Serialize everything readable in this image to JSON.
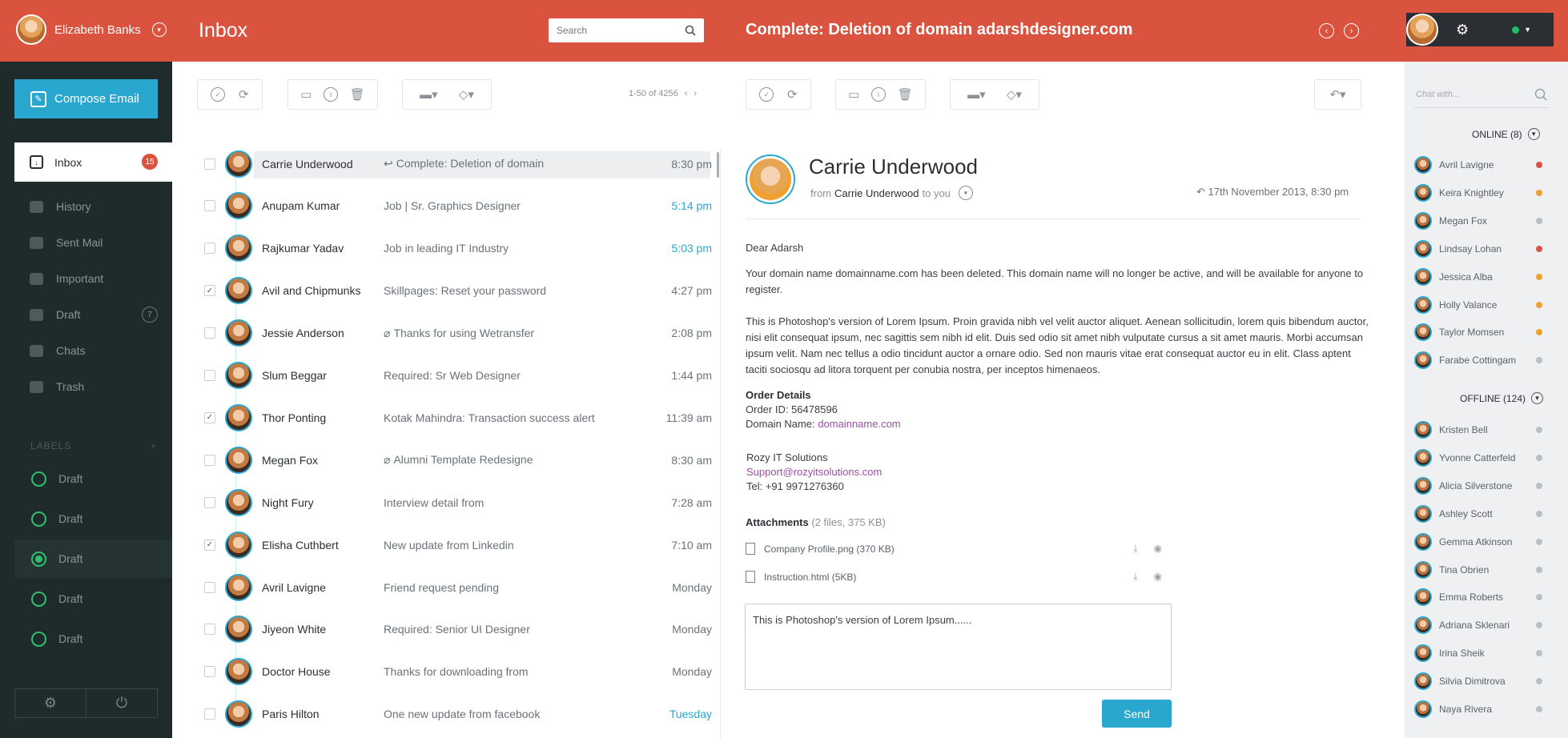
{
  "user": {
    "name": "Elizabeth Banks"
  },
  "header": {
    "title": "Inbox",
    "search_placeholder": "Search",
    "subject": "Complete: Deletion of domain adarshdesigner.com"
  },
  "sidebar": {
    "compose_label": "Compose Email",
    "inbox": {
      "label": "Inbox",
      "count": "15"
    },
    "items": [
      {
        "label": "History"
      },
      {
        "label": "Sent Mail"
      },
      {
        "label": "Important"
      },
      {
        "label": "Draft",
        "count": "7"
      },
      {
        "label": "Chats"
      },
      {
        "label": "Trash"
      }
    ],
    "labels_title": "LABELS",
    "labels_add": "+",
    "labels": [
      {
        "label": "Draft"
      },
      {
        "label": "Draft"
      },
      {
        "label": "Draft",
        "active": true
      },
      {
        "label": "Draft"
      },
      {
        "label": "Draft"
      }
    ]
  },
  "list": {
    "pager": "1-50 of 4256",
    "rows": [
      {
        "sender": "Carrie Underwood",
        "subject": "Complete: Deletion of domain",
        "time": "8:30 pm",
        "prefix": "↩",
        "selected": true,
        "checked": false,
        "time_color": "#6a7278"
      },
      {
        "sender": "Anupam Kumar",
        "subject": "Job | Sr. Graphics Designer",
        "time": "5:14 pm",
        "prefix": "",
        "checked": false,
        "time_color": "#2aa7cf"
      },
      {
        "sender": "Rajkumar Yadav",
        "subject": "Job in leading IT Industry",
        "time": "5:03 pm",
        "prefix": "",
        "checked": false,
        "time_color": "#2aa7cf"
      },
      {
        "sender": "Avil and Chipmunks",
        "subject": "Skillpages: Reset your password",
        "time": "4:27 pm",
        "prefix": "",
        "checked": true,
        "time_color": "#6a7278"
      },
      {
        "sender": "Jessie Anderson",
        "subject": "Thanks for using Wetransfer",
        "time": "2:08 pm",
        "prefix": "⌀",
        "checked": false,
        "time_color": "#6a7278"
      },
      {
        "sender": "Slum Beggar",
        "subject": "Required: Sr Web Designer",
        "time": "1:44 pm",
        "prefix": "",
        "checked": false,
        "time_color": "#6a7278"
      },
      {
        "sender": "Thor Ponting",
        "subject": "Kotak Mahindra: Transaction success alert",
        "time": "11:39 am",
        "prefix": "",
        "checked": true,
        "time_color": "#6a7278"
      },
      {
        "sender": "Megan Fox",
        "subject": "Alumni Template Redesigne",
        "time": "8:30 am",
        "prefix": "⌀",
        "checked": false,
        "time_color": "#6a7278"
      },
      {
        "sender": "Night Fury",
        "subject": "Interview detail from",
        "time": "7:28 am",
        "prefix": "",
        "checked": false,
        "time_color": "#6a7278"
      },
      {
        "sender": "Elisha Cuthbert",
        "subject": "New update from Linkedin",
        "time": "7:10 am",
        "prefix": "",
        "checked": true,
        "time_color": "#6a7278"
      },
      {
        "sender": "Avril Lavigne",
        "subject": "Friend request pending",
        "time": "Monday",
        "prefix": "",
        "checked": false,
        "time_color": "#6a7278"
      },
      {
        "sender": "Jiyeon White",
        "subject": "Required: Senior UI Designer",
        "time": "Monday",
        "prefix": "",
        "checked": false,
        "time_color": "#6a7278"
      },
      {
        "sender": "Doctor House",
        "subject": "Thanks for downloading from",
        "time": "Monday",
        "prefix": "",
        "checked": false,
        "time_color": "#6a7278"
      },
      {
        "sender": "Paris Hilton",
        "subject": "One new update from facebook",
        "time": "Tuesday",
        "prefix": "",
        "checked": false,
        "time_color": "#2aa7cf"
      }
    ]
  },
  "mail": {
    "sender": "Carrie Underwood",
    "from_label": "from",
    "to_label": "to you",
    "date": "17th November 2013, 8:30 pm",
    "greeting": "Dear Adarsh",
    "p1": "Your domain name domainname.com has been deleted. This domain name will no longer be active, and will be available for anyone to register.",
    "p2": "This is Photoshop's version  of Lorem Ipsum. Proin gravida nibh vel velit auctor aliquet. Aenean sollicitudin, lorem quis bibendum auctor, nisi elit consequat ipsum, nec sagittis sem nibh id elit. Duis sed odio sit amet nibh vulputate cursus a sit amet mauris. Morbi accumsan ipsum velit. Nam nec tellus a odio tincidunt auctor a ornare odio. Sed non  mauris vitae erat consequat auctor eu in elit. Class aptent taciti sociosqu ad litora torquent per conubia nostra, per inceptos himenaeos.",
    "order_title": "Order Details",
    "order_id": "Order ID: 56478596",
    "domain_label": "Domain Name: ",
    "domain": "domainname.com",
    "company": "Rozy IT Solutions",
    "support": "Support@rozyitsolutions.com",
    "tel": "Tel: +91 9971276360",
    "attach_title": "Attachments",
    "attach_meta": " (2 files, 375 KB)",
    "attachments": [
      {
        "name": "Company Profile.png (370 KB)"
      },
      {
        "name": "Instruction.html (5KB)"
      }
    ],
    "reply_text": "This is Photoshop's version  of Lorem Ipsum......",
    "send_label": "Send"
  },
  "chat": {
    "search_placeholder": "Chat with...",
    "online_label": "ONLINE (8)",
    "offline_label": "OFFLINE (124)",
    "online": [
      {
        "name": "Avril Lavigne",
        "status_color": "#d9533f"
      },
      {
        "name": "Keira Knightley",
        "status_color": "#f0a030"
      },
      {
        "name": "Megan Fox",
        "status_color": "#b9bfc3"
      },
      {
        "name": "Lindsay Lohan",
        "status_color": "#d9533f"
      },
      {
        "name": "Jessica Alba",
        "status_color": "#f0a030"
      },
      {
        "name": "Holly Valance",
        "status_color": "#f0a030"
      },
      {
        "name": "Taylor Momsen",
        "status_color": "#f0a030"
      },
      {
        "name": "Farabe Cottingam",
        "status_color": "#b9bfc3"
      }
    ],
    "offline": [
      {
        "name": "Kristen Bell"
      },
      {
        "name": "Yvonne Catterfeld"
      },
      {
        "name": "Alicia Silverstone"
      },
      {
        "name": "Ashley Scott"
      },
      {
        "name": "Gemma Atkinson"
      },
      {
        "name": "Tina Obrien"
      },
      {
        "name": "Emma Roberts"
      },
      {
        "name": "Adriana Sklenari"
      },
      {
        "name": "Irina Sheik"
      },
      {
        "name": "Silvia Dimitrova"
      },
      {
        "name": "Naya Rivera"
      }
    ]
  }
}
